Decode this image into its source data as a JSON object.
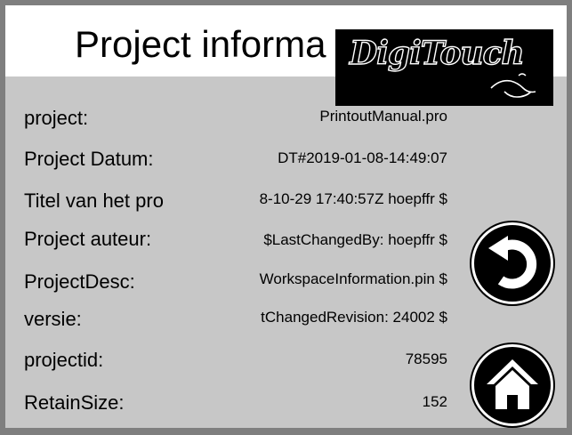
{
  "header": {
    "title": "Project informa",
    "logo_text": "DigiTouch"
  },
  "rows": [
    {
      "label": "project:",
      "value": "PrintoutManual.pro"
    },
    {
      "label": "Project Datum:",
      "value": "DT#2019-01-08-14:49:07"
    },
    {
      "label": "Titel van het pro",
      "value": "8-10-29 17:40:57Z hoepffr $"
    },
    {
      "label": "Project auteur:",
      "value": "$LastChangedBy: hoepffr $"
    },
    {
      "label": "ProjectDesc:",
      "value": "WorkspaceInformation.pin $"
    },
    {
      "label": "versie:",
      "value": "tChangedRevision: 24002 $"
    },
    {
      "label": "projectid:",
      "value": "78595"
    },
    {
      "label": "RetainSize:",
      "value": "152"
    }
  ],
  "buttons": {
    "back_icon": "back-arrow-icon",
    "home_icon": "home-icon"
  },
  "colors": {
    "background": "#c7c7c7",
    "frame": "#7f7f7f",
    "titlebar": "#ffffff",
    "button": "#000000"
  }
}
